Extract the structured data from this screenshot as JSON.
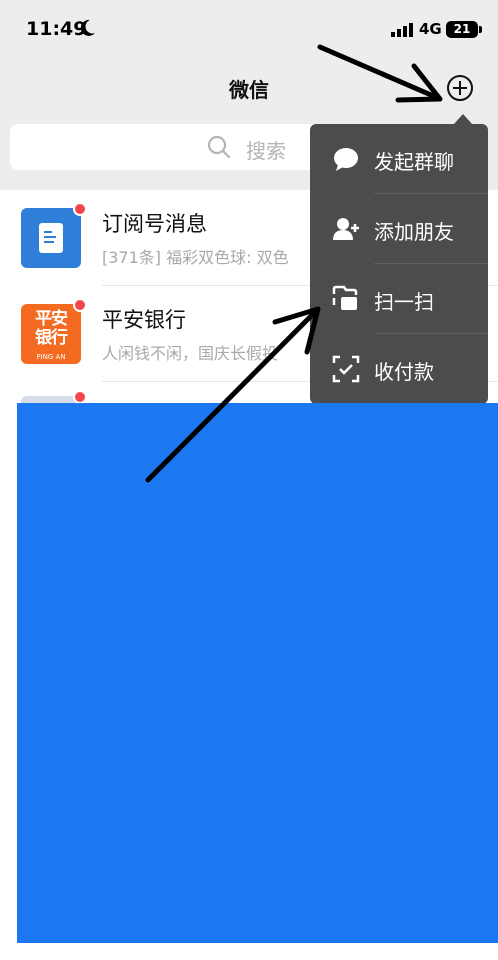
{
  "status_bar": {
    "time": "11:49",
    "network": "4G",
    "battery": "21"
  },
  "nav": {
    "title": "微信"
  },
  "search": {
    "placeholder": "搜索"
  },
  "chats": [
    {
      "title": "订阅号消息",
      "preview": "[371条] 福彩双色球: 双色",
      "avatar": "subscription-icon",
      "unread": true
    },
    {
      "title": "平安银行",
      "preview": "人闲钱不闲，国庆长假投",
      "avatar": "pingan-logo",
      "unread": true,
      "avatar_text": "平安银行",
      "avatar_subtext": "PING AN"
    }
  ],
  "menu": {
    "items": [
      {
        "label": "发起群聊",
        "icon": "chat-bubble-icon"
      },
      {
        "label": "添加朋友",
        "icon": "add-friend-icon"
      },
      {
        "label": "扫一扫",
        "icon": "scan-icon"
      },
      {
        "label": "收付款",
        "icon": "payment-icon"
      }
    ]
  },
  "colors": {
    "menu_background": "#4c4c4c",
    "cover_blue": "#1b78f0",
    "unread_dot": "#f5464a",
    "pingan_orange": "#f36a20",
    "subscription_blue": "#2f7ed8"
  }
}
